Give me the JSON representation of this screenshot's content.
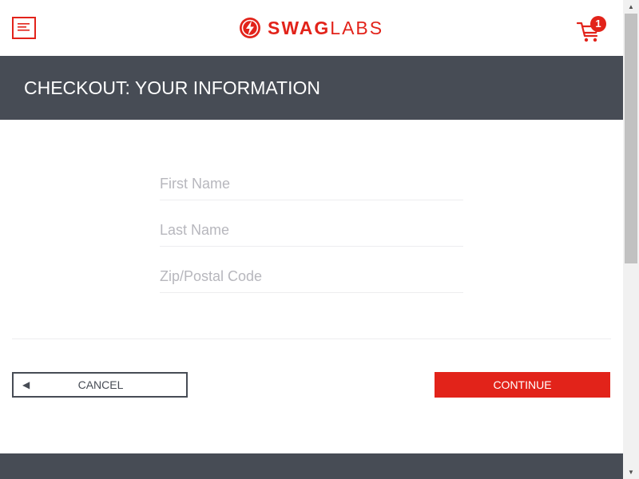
{
  "header": {
    "menu_icon": "hamburger-menu-icon",
    "logo": {
      "icon": "lightning-bolt-logo-icon",
      "swag": "SWAG",
      "labs": "LABS"
    },
    "cart": {
      "icon": "shopping-cart-icon",
      "badge_count": "1"
    }
  },
  "title_bar": {
    "title": "CHECKOUT: YOUR INFORMATION"
  },
  "form": {
    "first_name": {
      "value": "",
      "placeholder": "First Name"
    },
    "last_name": {
      "value": "",
      "placeholder": "Last Name"
    },
    "postal_code": {
      "value": "",
      "placeholder": "Zip/Postal Code"
    }
  },
  "actions": {
    "cancel_icon": "left-triangle-icon",
    "cancel_arrow": "◀",
    "cancel_label": "CANCEL",
    "continue_label": "CONTINUE"
  },
  "scrollbar": {
    "up_arrow": "▲",
    "down_arrow": "▼"
  },
  "colors": {
    "brand_red": "#e2231a",
    "dark_gray": "#474c55",
    "placeholder": "#b7b7bd",
    "divider": "#ededef"
  }
}
